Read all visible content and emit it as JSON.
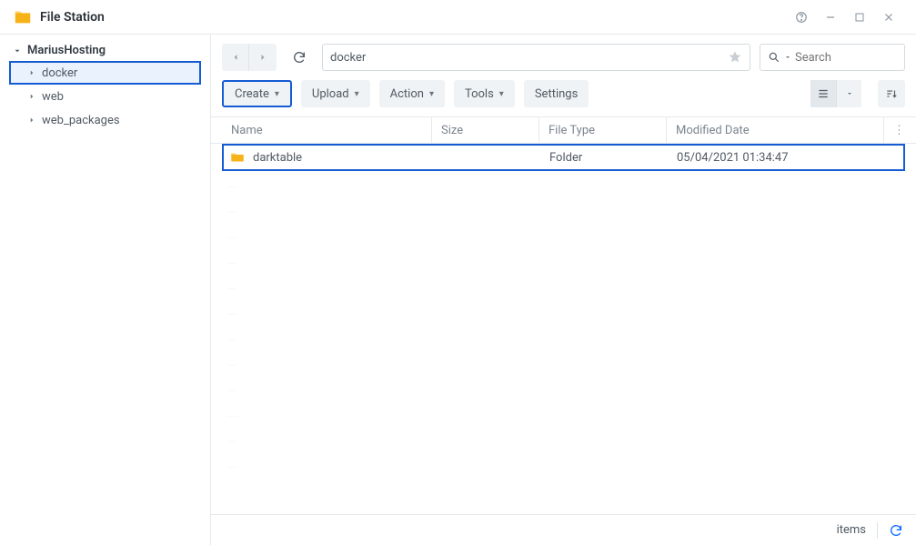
{
  "app": {
    "title": "File Station"
  },
  "sidebar": {
    "root": "MariusHosting",
    "items": [
      {
        "label": "docker",
        "selected": true
      },
      {
        "label": "web",
        "selected": false
      },
      {
        "label": "web_packages",
        "selected": false
      }
    ]
  },
  "path": {
    "current": "docker"
  },
  "search": {
    "placeholder": "Search"
  },
  "toolbar": {
    "create": "Create",
    "upload": "Upload",
    "action": "Action",
    "tools": "Tools",
    "settings": "Settings"
  },
  "columns": {
    "name": "Name",
    "size": "Size",
    "type": "File Type",
    "date": "Modified Date"
  },
  "rows": [
    {
      "name": "darktable",
      "size": "",
      "type": "Folder",
      "date": "05/04/2021 01:34:47",
      "highlight": true
    }
  ],
  "status": {
    "items_label": "items"
  }
}
